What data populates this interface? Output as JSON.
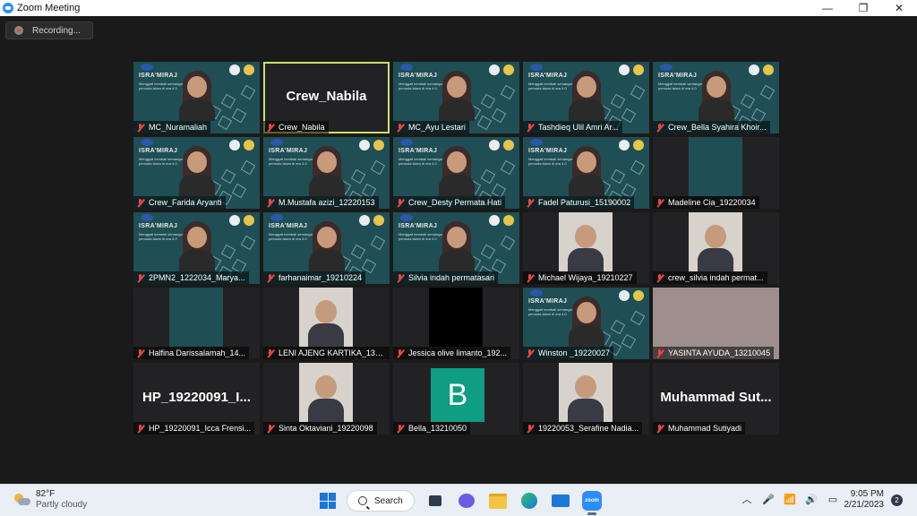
{
  "window": {
    "title": "Zoom Meeting",
    "minimize": "—",
    "maximize": "❐",
    "close": "✕"
  },
  "recording": {
    "label": "Recording..."
  },
  "event_bg": {
    "title": "ISRA'MIRAJ",
    "subtitle": "Menggali kembali semangat pemuda islam di era 4.0"
  },
  "participants": [
    {
      "name": "MC_Nuramaliah",
      "type": "event-person"
    },
    {
      "name": "Crew_Nabila",
      "type": "name-only",
      "display": "Crew_Nabila",
      "active": true
    },
    {
      "name": "MC_Ayu Lestari",
      "type": "event-person"
    },
    {
      "name": "Tashdieq Ulil Amri Ar...",
      "type": "event-person"
    },
    {
      "name": "Crew_Bella Syahira Khoir...",
      "type": "event-person"
    },
    {
      "name": "Crew_Farida Aryanti",
      "type": "event-person"
    },
    {
      "name": "M.Mustafa azizi_12220153",
      "type": "event-person"
    },
    {
      "name": "Crew_Desty Permata Hati",
      "type": "event-person"
    },
    {
      "name": "Fadel Paturusi_15190002",
      "type": "event-person"
    },
    {
      "name": "Madeline Cia_19220034",
      "type": "dark-box"
    },
    {
      "name": "2PMN2_1222034_Marya...",
      "type": "event-person"
    },
    {
      "name": "farhanaimar_19210224",
      "type": "event-person"
    },
    {
      "name": "Silvia indah permatasari",
      "type": "event-person"
    },
    {
      "name": "Michael Wijaya_19210227",
      "type": "photo"
    },
    {
      "name": "crew_silvia indah permat...",
      "type": "photo"
    },
    {
      "name": "Halfina Darissalamah_14...",
      "type": "dark-box"
    },
    {
      "name": "LENI AJENG KARTIKA_131...",
      "type": "photo"
    },
    {
      "name": "Jessica olive limanto_192...",
      "type": "black-box"
    },
    {
      "name": "Winston _19220027",
      "type": "event-person"
    },
    {
      "name": "YASINTA AYUDA_13210045",
      "type": "blur"
    },
    {
      "name": "HP_19220091_Icca Frensi...",
      "type": "name-only",
      "display": "HP_19220091_I..."
    },
    {
      "name": "Sinta Oktaviani_19220098",
      "type": "photo"
    },
    {
      "name": "Bella_13210050",
      "type": "letter",
      "display": "B"
    },
    {
      "name": "19220053_Serafine Nadia...",
      "type": "photo"
    },
    {
      "name": "Muhammad Sutiyadi",
      "type": "name-only",
      "display": "Muhammad Sut..."
    }
  ],
  "taskbar": {
    "weather": {
      "temp": "82°F",
      "condition": "Partly cloudy"
    },
    "search_label": "Search",
    "clock": {
      "time": "9:05 PM",
      "date": "2/21/2023"
    },
    "notification_count": "2",
    "icons": [
      "windows-icon",
      "task-view-icon",
      "chat-icon",
      "file-explorer-icon",
      "edge-icon",
      "mail-icon",
      "zoom-icon"
    ],
    "tray": {
      "chevron": "︿",
      "mic": "🎤",
      "wifi": "📶",
      "volume": "🔊",
      "battery": "▭"
    }
  }
}
